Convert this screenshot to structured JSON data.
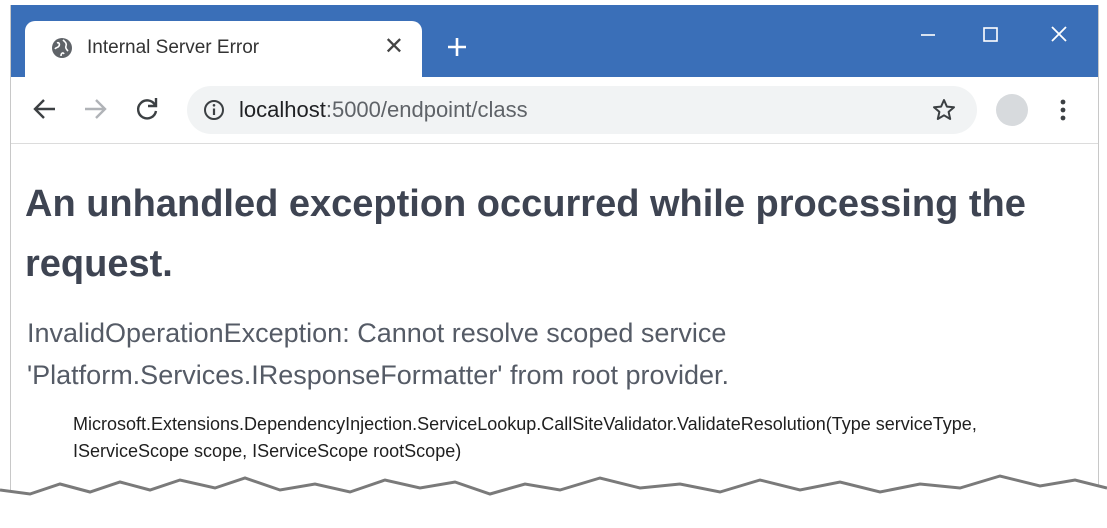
{
  "tab": {
    "title": "Internal Server Error",
    "close_glyph": "✕",
    "favicon": "globe-icon"
  },
  "window_controls": [
    "minimize-icon",
    "maximize-icon",
    "close-icon"
  ],
  "toolbar": {
    "back": "back-arrow-icon",
    "forward": "forward-arrow-icon",
    "reload": "reload-icon",
    "url_host": "localhost",
    "url_rest": ":5000/endpoint/class",
    "bookmark": "star-icon",
    "menu": "kebab-menu-icon"
  },
  "page": {
    "heading": "An unhandled exception occurred while processing the request.",
    "exception": "InvalidOperationException: Cannot resolve scoped service 'Platform.Services.IResponseFormatter' from root provider.",
    "stack_line": "Microsoft.Extensions.DependencyInjection.ServiceLookup.CallSiteValidator.ValidateResolution(Type serviceType, IServiceScope scope, IServiceScope rootScope)"
  },
  "colors": {
    "titlebar": "#3a6fb8",
    "omnibox": "#f1f3f4",
    "heading": "#3e4452",
    "message": "#555b66"
  }
}
